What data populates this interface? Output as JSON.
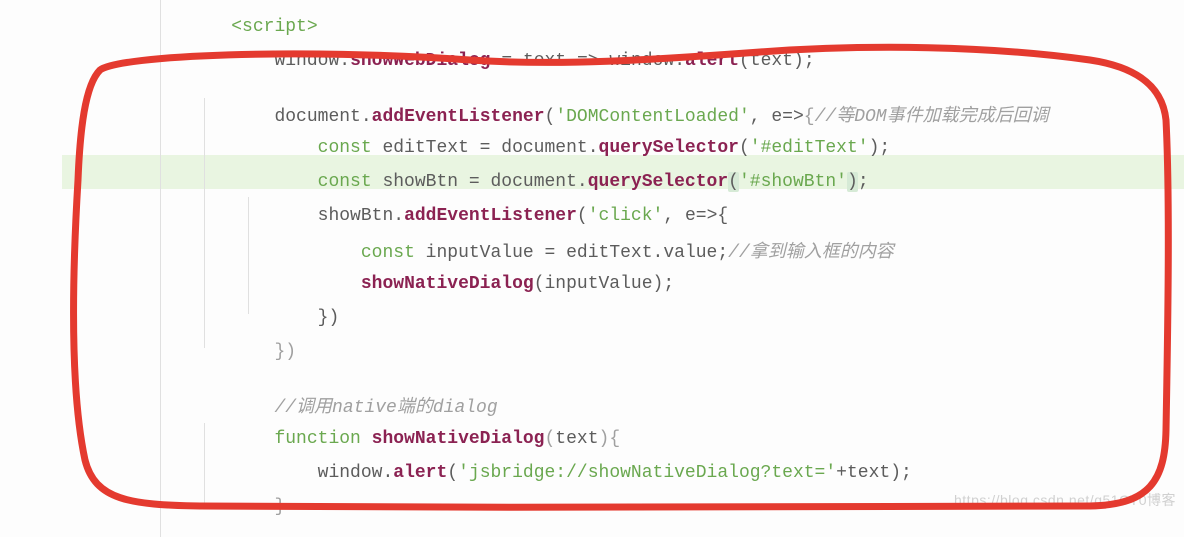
{
  "gutter": [
    "",
    "",
    "",
    "",
    "",
    "",
    "",
    "",
    "",
    "",
    "",
    "",
    "",
    "",
    ""
  ],
  "line0": {
    "tag": "<script>"
  },
  "line1": {
    "w": "window",
    "d1": ".",
    "fn": "showWebDialog",
    "sp": " ",
    "eq": "=",
    "sp2": " ",
    "txt": "text",
    "arr": " => ",
    "w2": "window",
    "d2": ".",
    "alert": "alert",
    "lp": "(",
    "arg": "text",
    "rp": ")",
    "sc": ";"
  },
  "line3": {
    "doc": "document",
    "d1": ".",
    "add": "addEventListener",
    "lp": "(",
    "str": "'DOMContentLoaded'",
    "c": ", ",
    "e": "e",
    "arr": "=>",
    "br": "{",
    "cmt": "//等DOM事件加载完成后回调"
  },
  "line4": {
    "kw": "const ",
    "v": "editText",
    "eq": " = ",
    "doc": "document",
    "d": ".",
    "qs": "querySelector",
    "lp": "(",
    "str": "'#editText'",
    "rp": ")",
    "sc": ";"
  },
  "line5": {
    "kw": "const ",
    "v": "showBtn",
    "eq": " = ",
    "doc": "document",
    "d": ".",
    "qs": "querySelector",
    "lp": "(",
    "str": "'#showBtn'",
    "rp": ")",
    "sc": ";"
  },
  "line6": {
    "v": "showBtn",
    "d": ".",
    "add": "addEventListener",
    "lp": "(",
    "str": "'click'",
    "c": ", ",
    "e": "e",
    "arr": "=>",
    "br": "{"
  },
  "line7": {
    "kw": "const ",
    "v": "inputValue",
    "eq": " = ",
    "et": "editText",
    "d": ".",
    "val": "value",
    "sc": ";",
    "cmt": "//拿到输入框的内容"
  },
  "line8": {
    "fn": "showNativeDialog",
    "lp": "(",
    "arg": "inputValue",
    "rp": ")",
    "sc": ";"
  },
  "line9": {
    "br": "})"
  },
  "line10": {
    "br": "})"
  },
  "line12": {
    "cmt": "//调用native端的dialog"
  },
  "line13": {
    "kw": "function ",
    "fn": "showNativeDialog",
    "lp": "(",
    "arg": "text",
    "rp": ")",
    "br": "{"
  },
  "line14": {
    "w": "window",
    "d": ".",
    "alert": "alert",
    "lp": "(",
    "str": "'jsbridge://showNativeDialog?text='",
    "plus": "+",
    "arg": "text",
    "rp": ")",
    "sc": ";"
  },
  "line15": {
    "br": "}"
  },
  "watermark": "https://blog.csdn.net/q51CT0博客"
}
